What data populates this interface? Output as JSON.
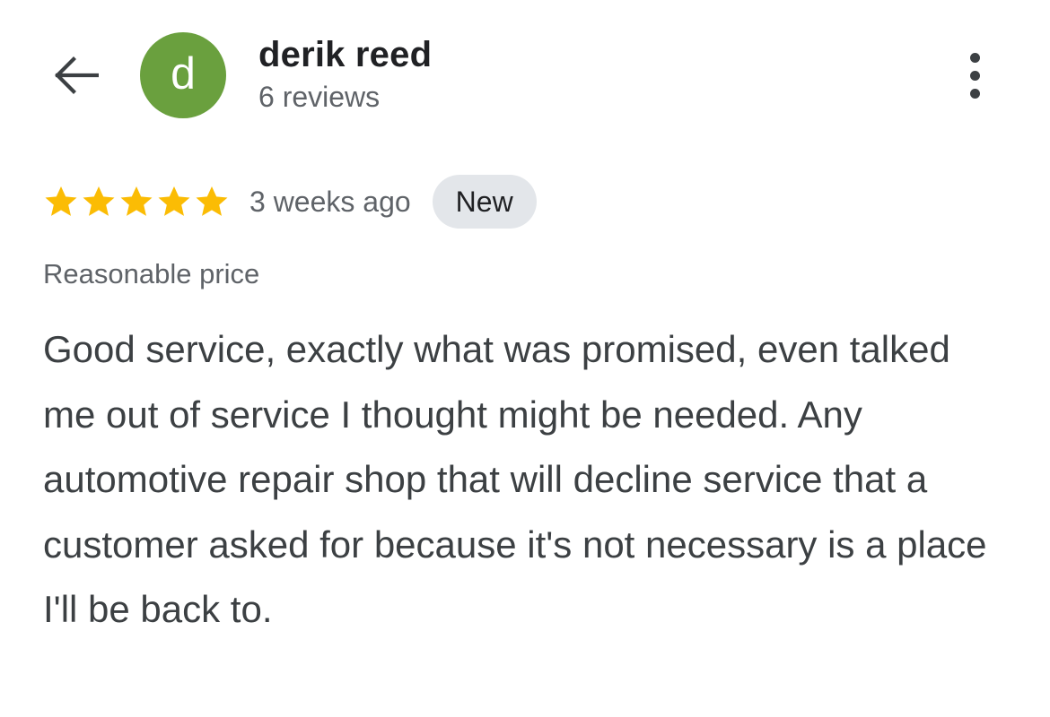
{
  "header": {
    "back_icon": "arrow-left-icon",
    "more_icon": "more-vert-icon"
  },
  "author": {
    "initial": "d",
    "avatar_color": "#6aa03e",
    "name": "derik reed",
    "review_count": "6 reviews"
  },
  "review": {
    "rating": 5,
    "max_rating": 5,
    "star_color": "#fbbc04",
    "time": "3 weeks ago",
    "badge": "New",
    "attribute": "Reasonable price",
    "text": "Good service, exactly what was promised, even talked me out of service I thought might be needed. Any automotive repair shop that will decline service that a customer asked for because it's not necessary is a place I'll be back to."
  }
}
